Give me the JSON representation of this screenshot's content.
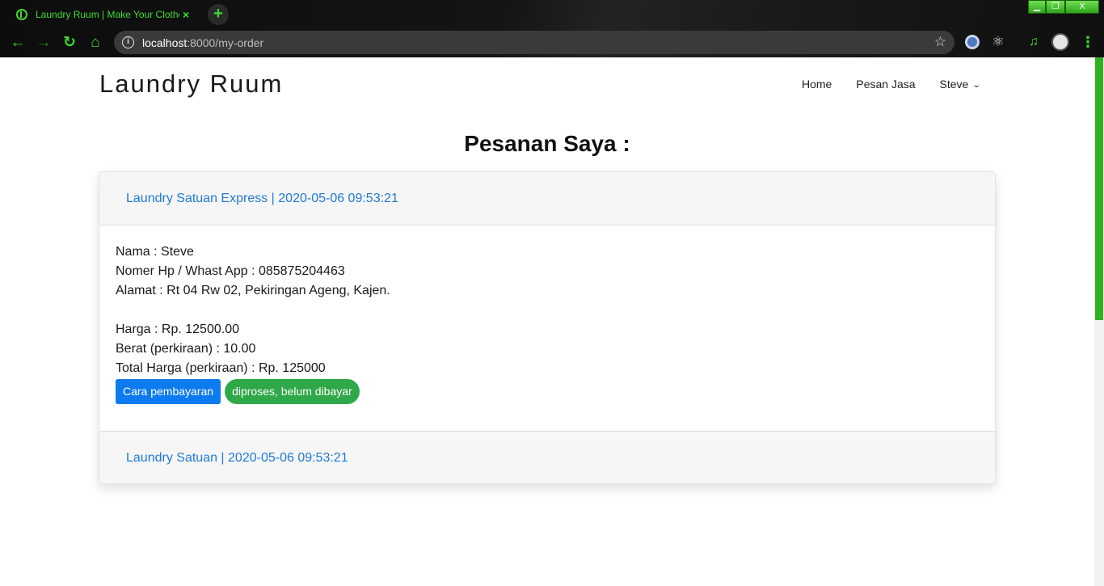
{
  "browser": {
    "tab_title": "Laundry Ruum | Make Your Clothes",
    "tab_close": "×",
    "new_tab": "+",
    "url_host": "localhost",
    "url_path": ":8000/my-order",
    "window_controls": {
      "minimize": "▁",
      "maximize": "❐",
      "close": "X"
    },
    "accent_color": "#3ddc2f"
  },
  "navbar": {
    "brand": "Laundry Ruum",
    "links": [
      "Home",
      "Pesan Jasa"
    ],
    "user_menu": "Steve"
  },
  "page": {
    "heading": "Pesanan Saya :"
  },
  "orders": [
    {
      "header": "Laundry Satuan Express | 2020-05-06 09:53:21",
      "nama": "Nama : Steve",
      "hp": "Nomer Hp / Whast App : 085875204463",
      "alamat": "Alamat : Rt 04 Rw 02, Pekiringan Ageng, Kajen.",
      "harga": "Harga : Rp. 12500.00",
      "berat": "Berat (perkiraan) : 10.00",
      "total": "Total Harga (perkiraan) : Rp. 125000",
      "payment_button": "Cara pembayaran",
      "status": "diproses, belum dibayar"
    },
    {
      "header": "Laundry Satuan | 2020-05-06 09:53:21"
    }
  ],
  "colors": {
    "link_blue": "#1f7ad6",
    "button_blue": "#0d7bf0",
    "status_green": "#2ea849",
    "scroll_thumb": "#2fb21f"
  }
}
